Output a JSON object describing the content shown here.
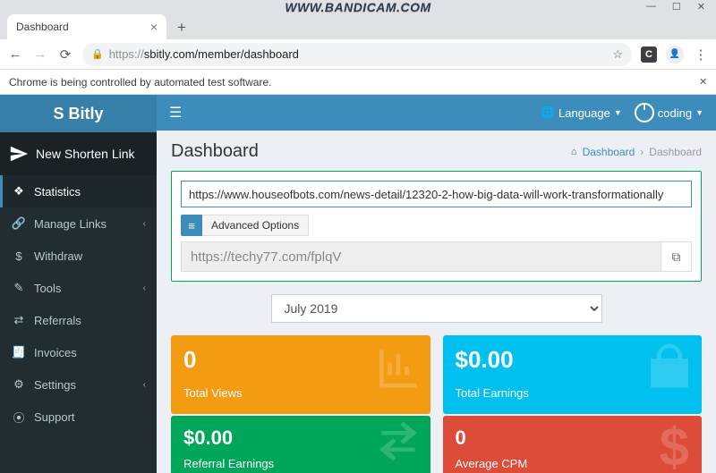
{
  "browser": {
    "tab_title": "Dashboard",
    "url_scheme": "https://",
    "url_rest": "sbitly.com/member/dashboard",
    "infobar": "Chrome is being controlled by automated test software.",
    "watermark": "WWW.BANDICAM.COM",
    "ext_label": "C"
  },
  "brand": "S Bitly",
  "shorten_label": "New Shorten Link",
  "sidebar": {
    "items": [
      {
        "icon": "❖",
        "label": "Statistics",
        "active": true
      },
      {
        "icon": "🔗",
        "label": "Manage Links",
        "chev": true
      },
      {
        "icon": "$",
        "label": "Withdraw"
      },
      {
        "icon": "✎",
        "label": "Tools",
        "chev": true
      },
      {
        "icon": "⇄",
        "label": "Referrals"
      },
      {
        "icon": "🧾",
        "label": "Invoices"
      },
      {
        "icon": "⚙",
        "label": "Settings",
        "chev": true
      },
      {
        "icon": "⦿",
        "label": "Support"
      }
    ]
  },
  "topbar": {
    "language_label": "Language",
    "user_label": "coding"
  },
  "page": {
    "title": "Dashboard",
    "crumb_home": "Dashboard",
    "crumb_current": "Dashboard"
  },
  "shortener": {
    "input_value": "https://www.houseofbots.com/news-detail/12320-2-how-big-data-will-work-transformationally",
    "advanced_label": "Advanced Options",
    "result_value": "https://techy77.com/fplqV"
  },
  "month_selector": {
    "selected": "July 2019"
  },
  "cards": {
    "views": {
      "value": "0",
      "label": "Total Views"
    },
    "earnings": {
      "value": "$0.00",
      "label": "Total Earnings"
    },
    "referral": {
      "value": "$0.00",
      "label": "Referral Earnings"
    },
    "cpm": {
      "value": "0",
      "label": "Average CPM"
    }
  }
}
